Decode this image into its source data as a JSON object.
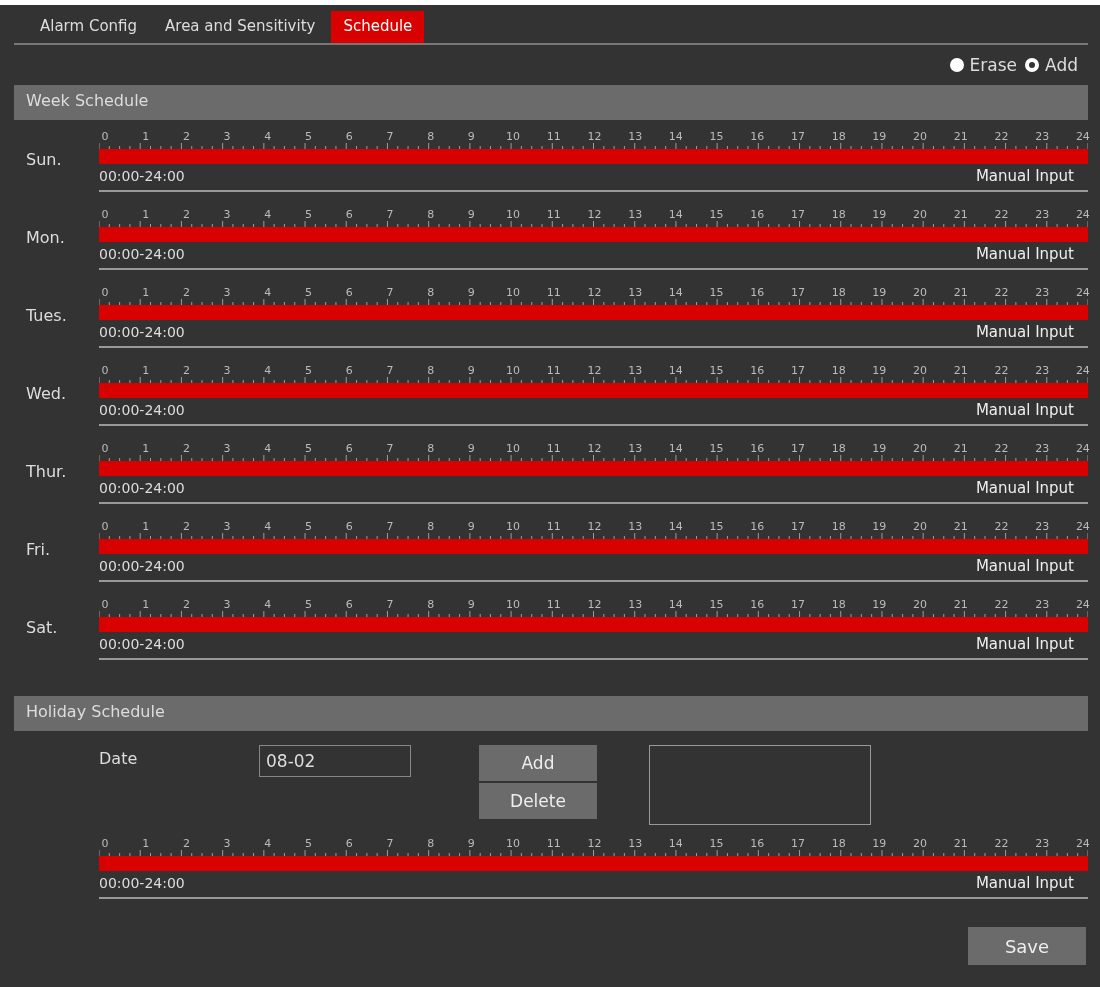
{
  "tabs": [
    {
      "label": "Alarm Config",
      "selected": false
    },
    {
      "label": "Area and Sensitivity",
      "selected": false
    },
    {
      "label": "Schedule",
      "selected": true
    }
  ],
  "mode": [
    {
      "label": "Erase",
      "selected": false
    },
    {
      "label": "Add",
      "selected": true
    }
  ],
  "week_schedule": {
    "title": "Week Schedule",
    "days": [
      {
        "day": "Sun.",
        "scale": [
          "0",
          "1",
          "2",
          "3",
          "4",
          "5",
          "6",
          "7",
          "8",
          "9",
          "10",
          "11",
          "12",
          "13",
          "14",
          "15",
          "16",
          "17",
          "18",
          "19",
          "20",
          "21",
          "22",
          "23",
          "24"
        ],
        "level": 1,
        "range": "00:00-24:00",
        "manual_input": "Manual Input"
      },
      {
        "day": "Mon.",
        "scale": [
          "0",
          "1",
          "2",
          "3",
          "4",
          "5",
          "6",
          "7",
          "8",
          "9",
          "10",
          "11",
          "12",
          "13",
          "14",
          "15",
          "16",
          "17",
          "18",
          "19",
          "20",
          "21",
          "22",
          "23",
          "24"
        ],
        "level": 1,
        "range": "00:00-24:00",
        "manual_input": "Manual Input"
      },
      {
        "day": "Tues.",
        "scale": [
          "0",
          "1",
          "2",
          "3",
          "4",
          "5",
          "6",
          "7",
          "8",
          "9",
          "10",
          "11",
          "12",
          "13",
          "14",
          "15",
          "16",
          "17",
          "18",
          "19",
          "20",
          "21",
          "22",
          "23",
          "24"
        ],
        "level": 1,
        "range": "00:00-24:00",
        "manual_input": "Manual Input"
      },
      {
        "day": "Wed.",
        "scale": [
          "0",
          "1",
          "2",
          "3",
          "4",
          "5",
          "6",
          "7",
          "8",
          "9",
          "10",
          "11",
          "12",
          "13",
          "14",
          "15",
          "16",
          "17",
          "18",
          "19",
          "20",
          "21",
          "22",
          "23",
          "24"
        ],
        "level": 1,
        "range": "00:00-24:00",
        "manual_input": "Manual Input"
      },
      {
        "day": "Thur.",
        "scale": [
          "0",
          "1",
          "2",
          "3",
          "4",
          "5",
          "6",
          "7",
          "8",
          "9",
          "10",
          "11",
          "12",
          "13",
          "14",
          "15",
          "16",
          "17",
          "18",
          "19",
          "20",
          "21",
          "22",
          "23",
          "24"
        ],
        "level": 1,
        "range": "00:00-24:00",
        "manual_input": "Manual Input"
      },
      {
        "day": "Fri.",
        "scale": [
          "0",
          "1",
          "2",
          "3",
          "4",
          "5",
          "6",
          "7",
          "8",
          "9",
          "10",
          "11",
          "12",
          "13",
          "14",
          "15",
          "16",
          "17",
          "18",
          "19",
          "20",
          "21",
          "22",
          "23",
          "24"
        ],
        "level": 1,
        "range": "00:00-24:00",
        "manual_input": "Manual Input"
      },
      {
        "day": "Sat.",
        "scale": [
          "0",
          "1",
          "2",
          "3",
          "4",
          "5",
          "6",
          "7",
          "8",
          "9",
          "10",
          "11",
          "12",
          "13",
          "14",
          "15",
          "16",
          "17",
          "18",
          "19",
          "20",
          "21",
          "22",
          "23",
          "24"
        ],
        "level": 1,
        "range": "00:00-24:00",
        "manual_input": "Manual Input"
      }
    ]
  },
  "holiday_schedule": {
    "title": "Holiday Schedule",
    "date_label": "Date",
    "date_value": "08-02",
    "buttons": [
      "Add",
      "Delete"
    ],
    "timeline": {
      "scale": [
        "0",
        "1",
        "2",
        "3",
        "4",
        "5",
        "6",
        "7",
        "8",
        "9",
        "10",
        "11",
        "12",
        "13",
        "14",
        "15",
        "16",
        "17",
        "18",
        "19",
        "20",
        "21",
        "22",
        "23",
        "24"
      ],
      "level": 1,
      "range": "00:00-24:00",
      "manual_input": "Manual Input"
    }
  },
  "save_button": "Save"
}
